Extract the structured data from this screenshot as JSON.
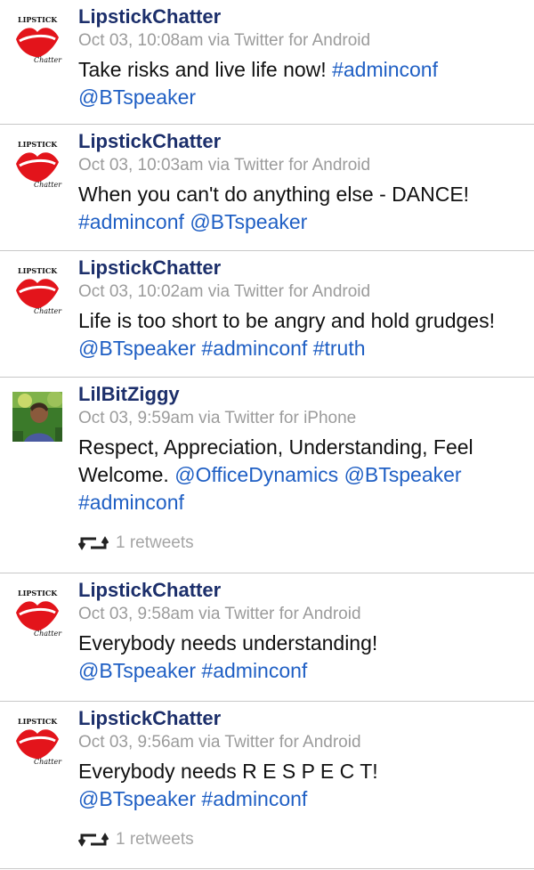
{
  "tweets": [
    {
      "author": "LipstickChatter",
      "meta": "Oct 03, 10:08am via Twitter for Android",
      "line1": "Take risks and live life now! ",
      "tag1": "#adminconf",
      "mention1": "@BTspeaker"
    },
    {
      "author": "LipstickChatter",
      "meta": "Oct 03, 10:03am via Twitter for Android",
      "line1": "When you can't do anything else - DANCE!",
      "tag1": "#adminconf",
      "mention1": "@BTspeaker"
    },
    {
      "author": "LipstickChatter",
      "meta": "Oct 03, 10:02am via Twitter for Android",
      "line1": "Life is too short to be angry and hold grudges! ",
      "mention1": "@BTspeaker",
      "tag1": "#adminconf",
      "tag2": "#truth"
    },
    {
      "author": "LilBitZiggy",
      "meta": "Oct 03, 9:59am via Twitter for iPhone",
      "line1": "Respect, Appreciation, Understanding, Feel Welcome. ",
      "mention1": "@OfficeDynamics",
      "mention2": "@BTspeaker",
      "tag1": "#adminconf",
      "retweets": "1 retweets"
    },
    {
      "author": "LipstickChatter",
      "meta": "Oct 03, 9:58am via Twitter for Android",
      "line1": "Everybody needs understanding!",
      "mention1": "@BTspeaker",
      "tag1": "#adminconf"
    },
    {
      "author": "LipstickChatter",
      "meta": "Oct 03, 9:56am via Twitter for Android",
      "line1": "Everybody needs R E S P E C T!",
      "mention1": "@BTspeaker",
      "tag1": "#adminconf",
      "retweets": "1 retweets"
    }
  ],
  "avatars": {
    "lipstick_logo": "LIPSTICK Chatter",
    "lips_color": "#e3141b"
  },
  "icons": {
    "retweet": "retweet-icon"
  }
}
